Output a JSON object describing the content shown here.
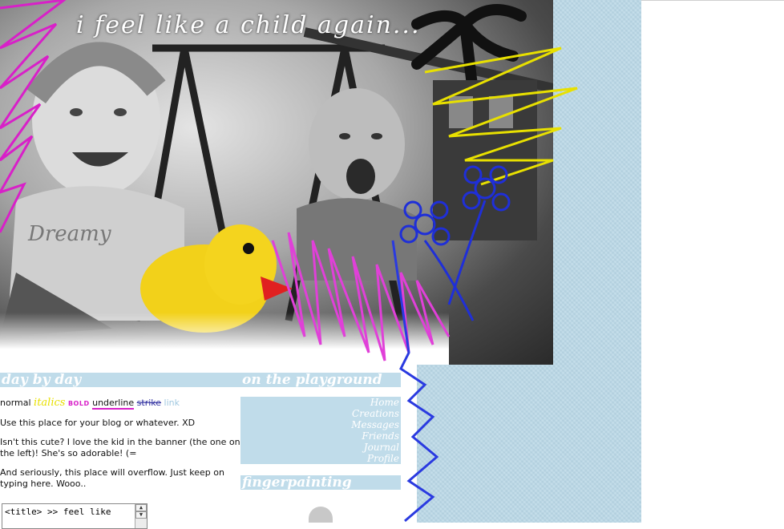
{
  "banner": {
    "title": "i feel like a child again..."
  },
  "left_column": {
    "heading": "day by day",
    "samples": {
      "normal": "normal",
      "italics": "italics",
      "bold": "BOLD",
      "underline": "underline",
      "strike": "strike",
      "link": "link"
    },
    "paragraphs": [
      "Use this place for your blog or whatever. XD",
      "Isn't this cute? I love the kid in the banner (the one on the left)! She's so adorable! (=",
      "And seriously, this place will overflow. Just keep on typing here. Wooo.."
    ],
    "title_box_text": "<title> >> feel like"
  },
  "right_column": {
    "heading": "on the playground",
    "nav": [
      "Home",
      "Creations",
      "Messages",
      "Friends",
      "Journal",
      "Profile"
    ],
    "second_heading": "fingerpainting"
  },
  "colors": {
    "accent_blue": "#c0dcea",
    "paper_blue": "#b9d7e6",
    "magenta": "#d820c8",
    "yellow": "#e8e000",
    "scribble_blue": "#1f2fd8"
  }
}
